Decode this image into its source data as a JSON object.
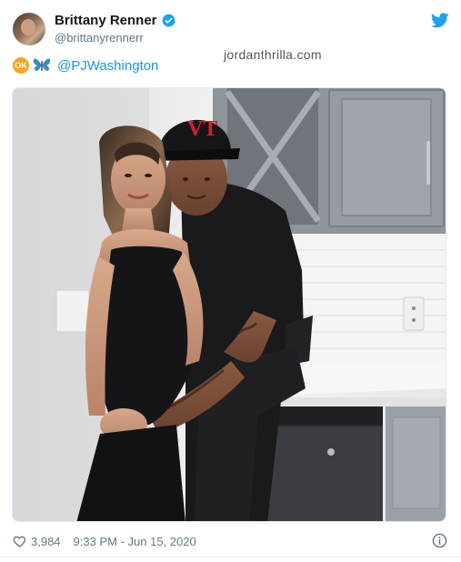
{
  "user": {
    "display_name": "Brittany Renner",
    "handle": "@brittanyrennerr",
    "verified": true
  },
  "watermark": "jordanthrilla.com",
  "tweet": {
    "emojis": [
      "ok-button-emoji",
      "butterfly-emoji"
    ],
    "mention": "@PJWashington"
  },
  "photo": {
    "cap_logo_icon": "cap-logo-icon"
  },
  "footer": {
    "likes": "3,984",
    "timestamp": "9:33 PM - Jun 15, 2020"
  },
  "colors": {
    "accent": "#1da1f2",
    "link": "#1b95e0",
    "muted": "#657786"
  }
}
